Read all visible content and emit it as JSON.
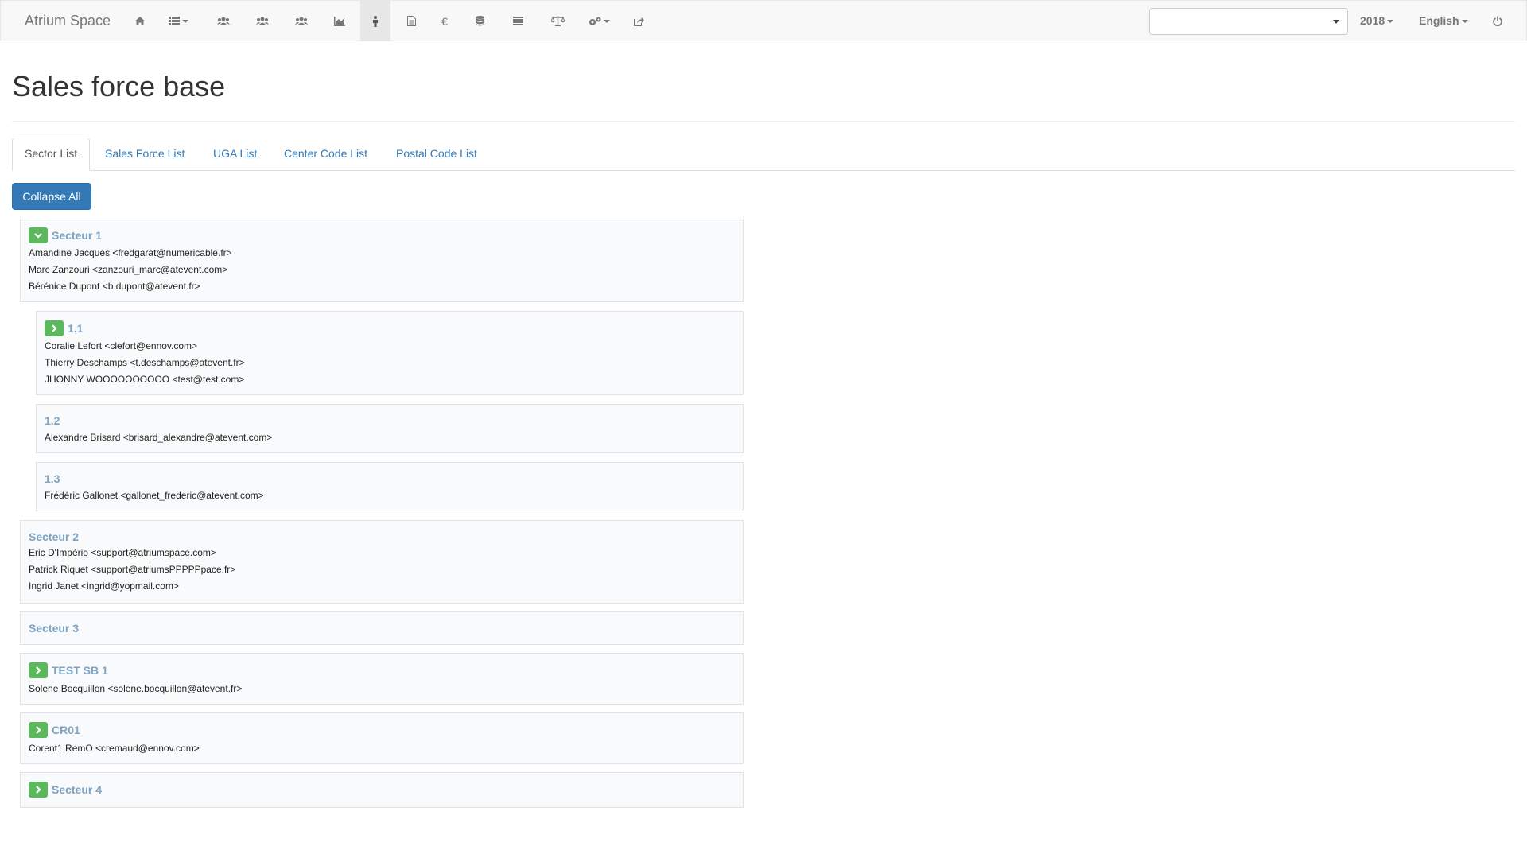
{
  "app": {
    "brand": "Atrium Space",
    "year": "2018",
    "language": "English",
    "select_value": ""
  },
  "nav_icons": [
    "home-icon",
    "list-menu-icon",
    "users-icon",
    "users-icon",
    "users-icon",
    "area-chart-icon",
    "person-icon",
    "file-icon",
    "euro-icon",
    "database-icon",
    "list-icon",
    "balance-scale-icon",
    "cogs-icon",
    "share-icon",
    "power-icon"
  ],
  "page": {
    "title": "Sales force base"
  },
  "tabs": [
    {
      "label": "Sector List",
      "active": true
    },
    {
      "label": "Sales Force List",
      "active": false
    },
    {
      "label": "UGA List",
      "active": false
    },
    {
      "label": "Center Code List",
      "active": false
    },
    {
      "label": "Postal Code List",
      "active": false
    }
  ],
  "actions": {
    "collapse_all": "Collapse All"
  },
  "sectors": [
    {
      "name": "Secteur 1",
      "toggle": "chevron-down",
      "members": [
        "Amandine Jacques <fredgarat@numericable.fr>",
        "Marc Zanzouri <zanzouri_marc@atevent.com>",
        "Bérénice Dupont <b.dupont@atevent.fr>"
      ],
      "children": [
        {
          "name": "1.1",
          "toggle": "chevron-right",
          "members": [
            "Coralie Lefort <clefort@ennov.com>",
            "Thierry Deschamps <t.deschamps@atevent.fr>",
            "JHONNY WOOOOOOOOOO <test@test.com>"
          ]
        },
        {
          "name": "1.2",
          "toggle": "",
          "members": [
            "Alexandre Brisard <brisard_alexandre@atevent.com>"
          ]
        },
        {
          "name": "1.3",
          "toggle": "",
          "members": [
            "Frédéric Gallonet <gallonet_frederic@atevent.com>"
          ]
        }
      ]
    },
    {
      "name": "Secteur 2",
      "toggle": "",
      "members": [
        "Eric D'Império <support@atriumspace.com>",
        "Patrick Riquet <support@atriumsPPPPPpace.fr>",
        "Ingrid Janet <ingrid@yopmail.com>"
      ]
    },
    {
      "name": "Secteur 3",
      "toggle": "",
      "members": []
    },
    {
      "name": "TEST SB 1",
      "toggle": "chevron-right",
      "members": [
        "Solene Bocquillon <solene.bocquillon@atevent.fr>"
      ]
    },
    {
      "name": "CR01",
      "toggle": "chevron-right",
      "members": [
        "Corent1 RemO <cremaud@ennov.com>"
      ]
    },
    {
      "name": "Secteur 4",
      "toggle": "chevron-right",
      "members": []
    }
  ]
}
